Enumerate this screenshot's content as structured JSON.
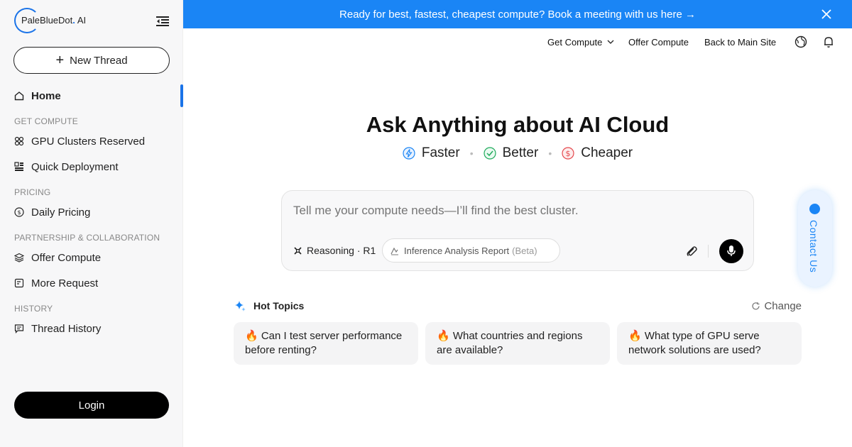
{
  "brand": {
    "name": "PaleBlueDot",
    "dot": ".",
    "suffix": "AI"
  },
  "sidebar": {
    "new_thread_label": "New Thread",
    "home_label": "Home",
    "sections": {
      "get_compute": "GET COMPUTE",
      "pricing": "PRICING",
      "partnership": "PARTNERSHIP & COLLABORATION",
      "history": "HISTORY"
    },
    "items": {
      "gpu_clusters": "GPU Clusters Reserved",
      "quick_deployment": "Quick Deployment",
      "daily_pricing": "Daily Pricing",
      "offer_compute": "Offer Compute",
      "more_request": "More Request",
      "thread_history": "Thread History"
    },
    "login_label": "Login"
  },
  "banner": {
    "text": "Ready for best, fastest, cheapest compute? Book a meeting with us here →"
  },
  "topnav": {
    "get_compute": "Get Compute",
    "offer_compute": "Offer Compute",
    "back_main": "Back to Main Site"
  },
  "hero": {
    "title": "Ask Anything about AI Cloud",
    "features": {
      "faster": "Faster",
      "better": "Better",
      "cheaper": "Cheaper"
    },
    "separator": "•"
  },
  "prompt": {
    "placeholder": "Tell me your compute needs—I’ll find the best cluster.",
    "reasoning": "Reasoning · R1",
    "chip_label": "Inference Analysis Report",
    "chip_beta": "(Beta)"
  },
  "contact": {
    "label": "Contact Us"
  },
  "hot_topics": {
    "title": "Hot Topics",
    "change_label": "Change",
    "cards": [
      "🔥 Can I test server performance before renting?",
      "🔥 What countries and regions are available?",
      "🔥 What type of GPU serve network solutions are used?"
    ]
  },
  "colors": {
    "accent": "#1a85f5",
    "better": "#1faa5b",
    "cheaper": "#e5484d"
  }
}
